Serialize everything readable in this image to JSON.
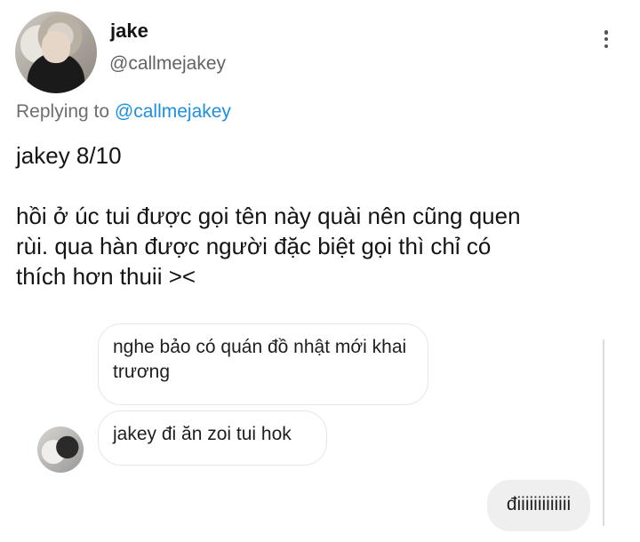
{
  "tweet": {
    "display_name": "jake",
    "handle": "@callmejakey",
    "replying_prefix": "Replying to ",
    "replying_to": "@callmejakey",
    "line1": "jakey 8/10",
    "line2": "hồi ở úc tui được gọi tên này quài nên cũng quen",
    "line3": "rùi. qua hàn được người đặc biệt gọi thì chỉ có",
    "line4": "thích hơn thuii ><"
  },
  "chat": {
    "messages": [
      {
        "text": "nghe bảo có quán đồ nhật mới khai trương"
      },
      {
        "text": "jakey đi ăn zoi tui hok"
      },
      {
        "text": "điiiiiiiiiiiii"
      }
    ]
  },
  "icons": {
    "more": "more-vertical-icon"
  }
}
